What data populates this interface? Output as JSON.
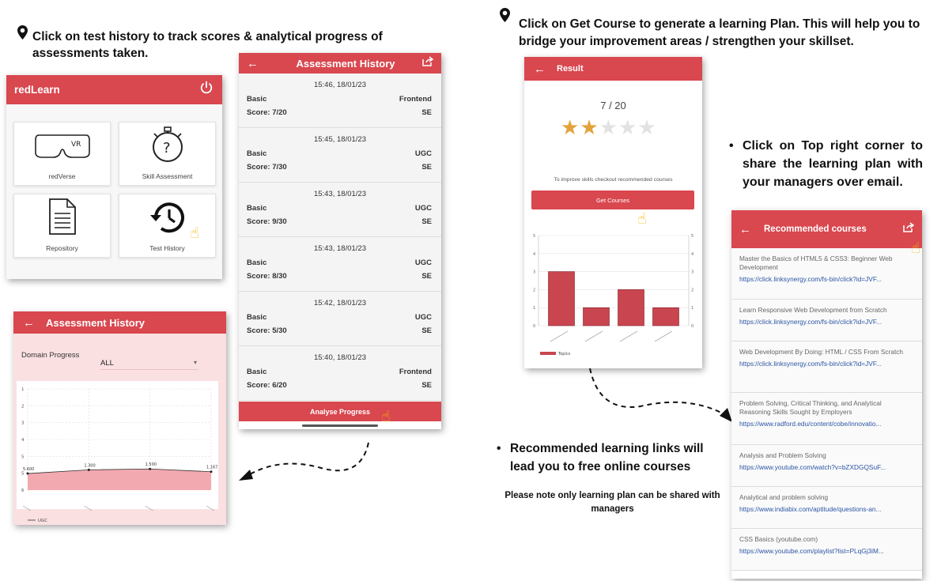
{
  "captions": {
    "top_left": "Click on test history to track scores & analytical progress of assessments taken.",
    "top_right": "Click on Get Course to generate a learning Plan. This will help you to bridge your improvement areas / strengthen your skillset.",
    "share": "Click on Top right corner to share the learning plan with your managers over email.",
    "links": "Recommended learning links will lead you to free online courses",
    "note": "Please note only learning plan can be shared with managers"
  },
  "home": {
    "title": "redLearn",
    "tiles": [
      "redVerse",
      "Skill Assessment",
      "Repository",
      "Test History"
    ]
  },
  "history": {
    "title": "Assessment History",
    "items": [
      {
        "time": "15:46, 18/01/23",
        "level": "Basic",
        "domain": "Frontend",
        "score": "Score: 7/20",
        "code": "SE"
      },
      {
        "time": "15:45, 18/01/23",
        "level": "Basic",
        "domain": "UGC",
        "score": "Score: 7/30",
        "code": "SE"
      },
      {
        "time": "15:43, 18/01/23",
        "level": "Basic",
        "domain": "UGC",
        "score": "Score: 9/30",
        "code": "SE"
      },
      {
        "time": "15:43, 18/01/23",
        "level": "Basic",
        "domain": "UGC",
        "score": "Score: 8/30",
        "code": "SE"
      },
      {
        "time": "15:42, 18/01/23",
        "level": "Basic",
        "domain": "UGC",
        "score": "Score: 5/30",
        "code": "SE"
      },
      {
        "time": "15:40, 18/01/23",
        "level": "Basic",
        "domain": "Frontend",
        "score": "Score: 6/20",
        "code": "SE"
      }
    ],
    "button": "Analyse Progress"
  },
  "progress": {
    "title": "Assessment History",
    "label": "Domain Progress",
    "select": "ALL"
  },
  "result": {
    "title": "Result",
    "score": "7 / 20",
    "stars_filled": 2,
    "stars_total": 5,
    "hint": "To improve skills checkout recommended courses",
    "button": "Get Courses"
  },
  "recommended": {
    "title": "Recommended courses",
    "items": [
      {
        "title": "Master the Basics of HTML5 & CSS3: Beginner Web Development",
        "url": "https://click.linksynergy.com/fs-bin/click?id=JVF..."
      },
      {
        "title": "Learn Responsive Web Development from Scratch",
        "url": "https://click.linksynergy.com/fs-bin/click?id=JVF..."
      },
      {
        "title": "Web Development By Doing: HTML / CSS From Scratch",
        "url": "https://click.linksynergy.com/fs-bin/click?id=JVF..."
      },
      {
        "title": "Problem Solving, Critical Thinking, and Analytical Reasoning Skills Sought by Employers",
        "url": "https://www.radford.edu/content/cobe/innovatio..."
      },
      {
        "title": "Analysis and Problem Solving",
        "url": "https://www.youtube.com/watch?v=bZXDGQSuF..."
      },
      {
        "title": "Analytical and problem solving",
        "url": "https://www.indiabix.com/aptitude/questions-an..."
      },
      {
        "title": "CSS Basics (youtube.com)",
        "url": "https://www.youtube.com/playlist?list=PLqGj3iM..."
      }
    ]
  },
  "colors": {
    "accent": "#d9474f",
    "link": "#2b55a5",
    "star": "#e2a33a"
  },
  "chart_data": [
    {
      "type": "line",
      "x": [
        "",
        "",
        "",
        ""
      ],
      "values": [
        5.6,
        5.4,
        5.35,
        5.5
      ],
      "data_labels": [
        "5.600",
        "1.300",
        "1.500",
        "1.167"
      ],
      "series": [
        {
          "name": "UGC",
          "values": [
            5.6,
            5.4,
            5.35,
            5.5
          ]
        }
      ],
      "yticks": [
        "1",
        "2",
        "3",
        "4",
        "5",
        "5",
        "6"
      ],
      "ylim": [
        1,
        6.5
      ],
      "fill": true
    },
    {
      "type": "bar",
      "categories": [
        "",
        "",
        "",
        ""
      ],
      "values": [
        3,
        1,
        2,
        1
      ],
      "series": [
        {
          "name": "Topics",
          "values": [
            3,
            1,
            2,
            1
          ]
        }
      ],
      "yticks": [
        "0",
        "1",
        "2",
        "3",
        "4",
        "5"
      ],
      "ylim": [
        0,
        5
      ]
    }
  ]
}
